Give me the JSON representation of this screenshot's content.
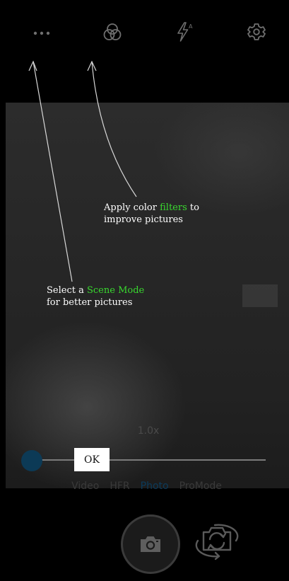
{
  "toolbar": {
    "scene_mode_icon": "more-dots-icon",
    "filter_icon": "color-filter-icon",
    "flash_icon": "flash-auto-icon",
    "flash_badge": "A",
    "settings_icon": "gear-icon"
  },
  "coach_marks": {
    "filters": {
      "line1_before": "Apply color ",
      "line1_highlight": "filters",
      "line1_after": " to",
      "line2": "improve pictures"
    },
    "scene": {
      "line1_before": "Select a ",
      "line1_highlight": "Scene Mode",
      "line2": "for better pictures"
    },
    "ok_label": "OK"
  },
  "viewfinder": {
    "zoom_label": "1.0x",
    "zoom_level": 0.0
  },
  "modes": {
    "items": [
      "Video",
      "HFR",
      "Photo",
      "ProMode"
    ],
    "active": "Photo"
  },
  "controls": {
    "shutter_icon": "camera-icon",
    "switch_camera_icon": "switch-camera-icon"
  },
  "colors": {
    "highlight": "#39d92f",
    "active_mode": "#0b3a5a",
    "zoom_knob": "#0c3a56"
  }
}
